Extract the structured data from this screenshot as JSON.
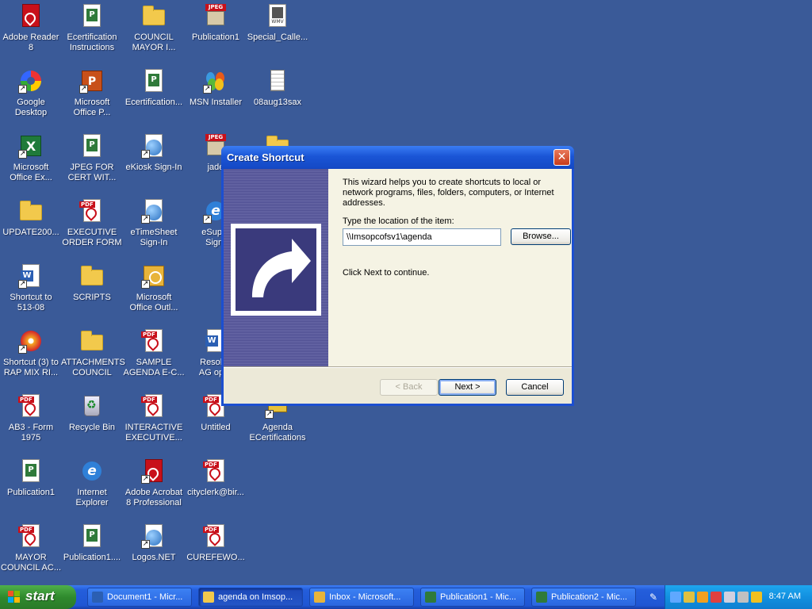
{
  "desktop": {
    "icons": [
      {
        "label": "Adobe Reader\n8",
        "icon": "pdf-reader-icon",
        "shortcut": false
      },
      {
        "label": "Ecertification\nInstructions",
        "icon": "publisher-doc-icon",
        "shortcut": false
      },
      {
        "label": "COUNCIL\nMAYOR I...",
        "icon": "folder-icon",
        "shortcut": false
      },
      {
        "label": "Publication1",
        "icon": "jpeg-file-icon",
        "shortcut": false
      },
      {
        "label": "Special_Calle...",
        "icon": "wmv-file-icon",
        "shortcut": false
      },
      {
        "label": "Google\nDesktop",
        "icon": "google-desktop-icon",
        "shortcut": true
      },
      {
        "label": "Microsoft\nOffice P...",
        "icon": "powerpoint-icon",
        "shortcut": true
      },
      {
        "label": "Ecertification...",
        "icon": "publisher-doc-icon",
        "shortcut": false
      },
      {
        "label": "MSN Installer",
        "icon": "msn-butterfly-icon",
        "shortcut": true
      },
      {
        "label": "08aug13sax",
        "icon": "notepad-icon",
        "shortcut": false
      },
      {
        "label": "Microsoft\nOffice Ex...",
        "icon": "excel-icon",
        "shortcut": true
      },
      {
        "label": "JPEG FOR\nCERT WIT...",
        "icon": "publisher-doc-icon",
        "shortcut": false
      },
      {
        "label": "eKiosk Sign-In",
        "icon": "globe-icon",
        "shortcut": true
      },
      {
        "label": "jade",
        "icon": "jpeg-file-icon",
        "shortcut": false
      },
      {
        "label": "",
        "icon": "folder-icon",
        "shortcut": false
      },
      {
        "label": "UPDATE200...",
        "icon": "folder-icon",
        "shortcut": false
      },
      {
        "label": "EXECUTIVE\nORDER FORM",
        "icon": "pdf-file-icon",
        "shortcut": false
      },
      {
        "label": "eTimeSheet\nSign-In",
        "icon": "globe-icon",
        "shortcut": true
      },
      {
        "label": "eSuper\nSign-",
        "icon": "ie-icon",
        "shortcut": true
      },
      {
        "label": "Shortcut to\n513-08",
        "icon": "word-doc-icon",
        "shortcut": true
      },
      {
        "label": "SCRIPTS",
        "icon": "folder-icon",
        "shortcut": false
      },
      {
        "label": "Microsoft\nOffice Outl...",
        "icon": "outlook-icon",
        "shortcut": true
      },
      {
        "label": "Shortcut (3) to\nRAP MIX RI...",
        "icon": "cd-audio-icon",
        "shortcut": true
      },
      {
        "label": "ATTACHMENTS\nCOUNCIL",
        "icon": "folder-icon",
        "shortcut": false
      },
      {
        "label": "SAMPLE\nAGENDA E-C...",
        "icon": "pdf-file-icon",
        "shortcut": false
      },
      {
        "label": "Resoluti\nAG opini",
        "icon": "word-doc-icon",
        "shortcut": false
      },
      {
        "label": "AB3 - Form\n1975",
        "icon": "pdf-file-icon",
        "shortcut": false
      },
      {
        "label": "Recycle Bin",
        "icon": "recycle-bin-icon",
        "shortcut": false
      },
      {
        "label": "INTERACTIVE\nEXECUTIVE...",
        "icon": "pdf-file-icon",
        "shortcut": false
      },
      {
        "label": "Untitled",
        "icon": "pdf-file-icon",
        "shortcut": false
      },
      {
        "label": "Agenda\nECertifications",
        "icon": "tool-icon",
        "shortcut": true
      },
      {
        "label": "Publication1",
        "icon": "publisher-doc-icon",
        "shortcut": false
      },
      {
        "label": "Internet\nExplorer",
        "icon": "ie-icon",
        "shortcut": false
      },
      {
        "label": "Adobe Acrobat\n8 Professional",
        "icon": "pdf-reader-icon",
        "shortcut": true
      },
      {
        "label": "cityclerk@bir...",
        "icon": "pdf-file-icon",
        "shortcut": false
      },
      {
        "label": "MAYOR\nCOUNCIL AC...",
        "icon": "pdf-file-icon",
        "shortcut": false
      },
      {
        "label": "Publication1....",
        "icon": "publisher-doc-icon",
        "shortcut": false
      },
      {
        "label": "Logos.NET",
        "icon": "globe-icon",
        "shortcut": true
      },
      {
        "label": "CUREFEWO...",
        "icon": "pdf-file-icon",
        "shortcut": false
      }
    ]
  },
  "dialog": {
    "title": "Create Shortcut",
    "close_icon": "close-icon",
    "intro": "This wizard helps you to create shortcuts to local or network programs, files, folders, computers, or Internet addresses.",
    "location_label": "Type the location of the item:",
    "location_value": "\\\\Imsopcofsv1\\agenda",
    "browse_label": "Browse...",
    "next_hint": "Click Next to continue.",
    "back_label": "< Back",
    "next_label": "Next >",
    "cancel_label": "Cancel",
    "side_art_icon": "shortcut-arrow-icon"
  },
  "taskbar": {
    "start_label": "start",
    "tasks": [
      {
        "label": "Document1 - Micr...",
        "icon": "word-icon",
        "color": "#2b5fb3",
        "active": false
      },
      {
        "label": "agenda on Imsop...",
        "icon": "folder-icon",
        "color": "#f2c94c",
        "active": true
      },
      {
        "label": "Inbox - Microsoft...",
        "icon": "outlook-icon",
        "color": "#e8b43a",
        "active": false
      },
      {
        "label": "Publication1 - Mic...",
        "icon": "publisher-icon",
        "color": "#2f7a3a",
        "active": false
      },
      {
        "label": "Publication2 - Mic...",
        "icon": "publisher-icon",
        "color": "#2f7a3a",
        "active": false
      }
    ],
    "tray": {
      "icons": [
        {
          "name": "back-arrow-icon",
          "color": "#5fa8ff"
        },
        {
          "name": "scanner-icon",
          "color": "#e0c040"
        },
        {
          "name": "clock-tray-icon",
          "color": "#f0a020"
        },
        {
          "name": "chrome-like-icon",
          "color": "#e04040"
        },
        {
          "name": "network-icon",
          "color": "#d0d0e0"
        },
        {
          "name": "printer-icon",
          "color": "#c0c0c0"
        },
        {
          "name": "shield-icon",
          "color": "#f0c020"
        }
      ],
      "clock": "8:47 AM"
    }
  }
}
